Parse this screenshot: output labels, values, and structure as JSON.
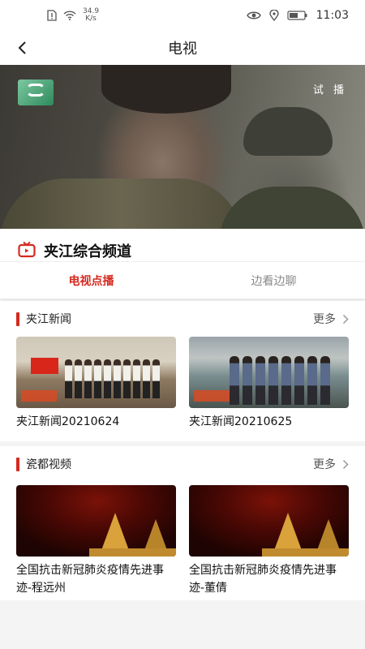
{
  "status": {
    "net_speed": "34.9",
    "net_unit": "K/s",
    "time": "11:03"
  },
  "nav": {
    "title": "电视"
  },
  "player": {
    "trial_label": "试 播"
  },
  "channel": {
    "name": "夹江综合频道"
  },
  "tabs": [
    {
      "label": "电视点播",
      "active": true
    },
    {
      "label": "边看边聊",
      "active": false
    }
  ],
  "sections": [
    {
      "title": "夹江新闻",
      "more": "更多",
      "items": [
        {
          "title": "夹江新闻20210624"
        },
        {
          "title": "夹江新闻20210625"
        }
      ]
    },
    {
      "title": "瓷都视频",
      "more": "更多",
      "items": [
        {
          "title": "全国抗击新冠肺炎疫情先进事迹-程远州"
        },
        {
          "title": "全国抗击新冠肺炎疫情先进事迹-董倩"
        }
      ]
    }
  ],
  "colors": {
    "accent": "#d42a1f",
    "background": "#f4f4f4"
  }
}
